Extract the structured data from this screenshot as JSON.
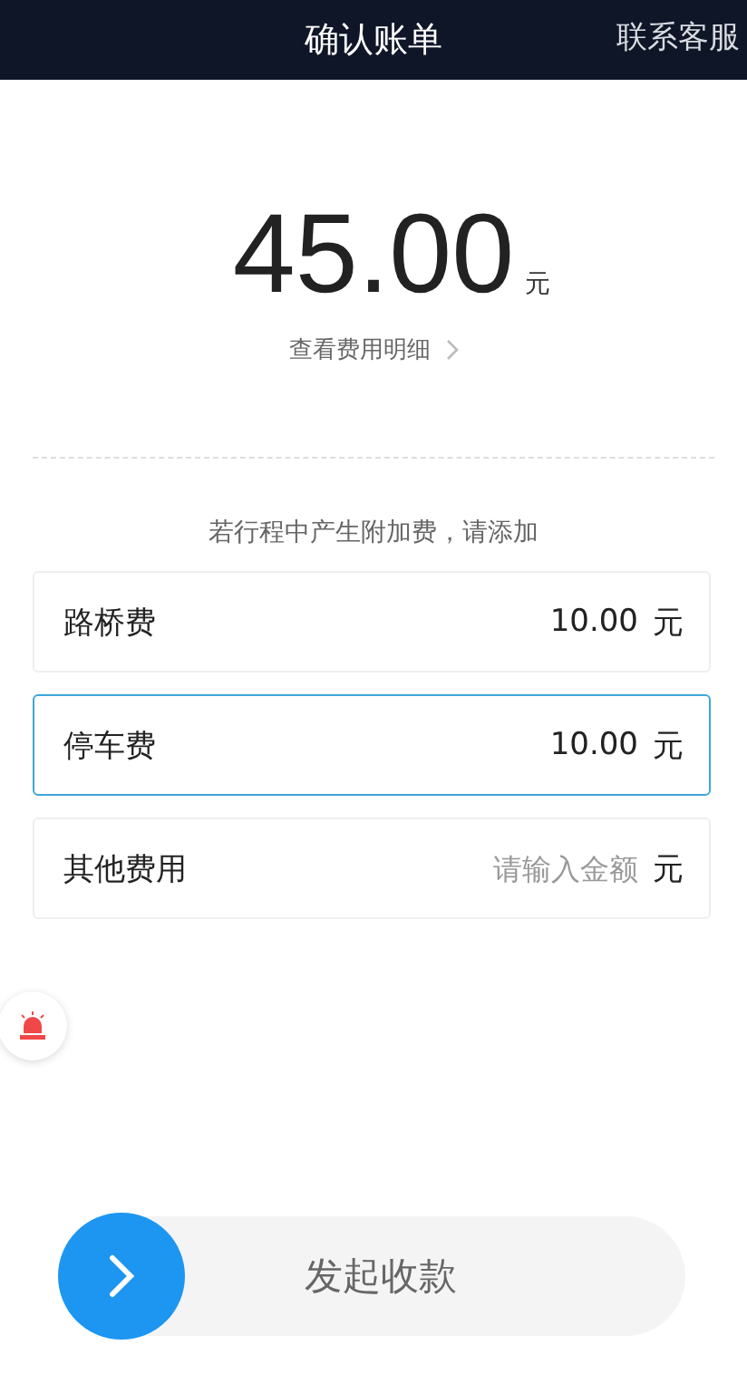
{
  "header": {
    "title": "确认账单",
    "action": "联系客服"
  },
  "total": {
    "amount": "45.00",
    "unit": "元",
    "details_link": "查看费用明细"
  },
  "extra_hint": "若行程中产生附加费，请添加",
  "fees": [
    {
      "label": "路桥费",
      "value": "10.00",
      "unit": "元",
      "selected": false
    },
    {
      "label": "停车费",
      "value": "10.00",
      "unit": "元",
      "selected": true
    },
    {
      "label": "其他费用",
      "placeholder": "请输入金额",
      "unit": "元",
      "selected": false
    }
  ],
  "slide_button": {
    "label": "发起收款"
  }
}
